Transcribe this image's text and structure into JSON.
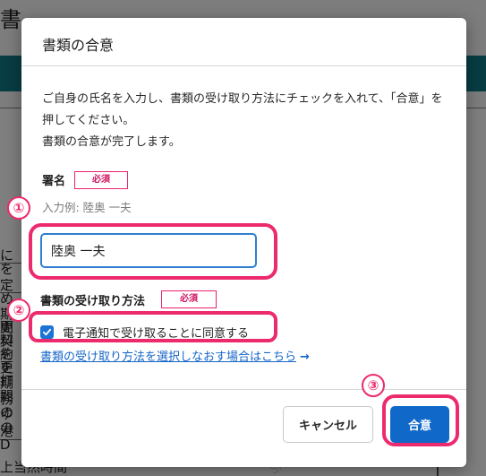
{
  "background": {
    "header_title": "書",
    "doc_fragments": [
      "にを",
      "定め",
      "期間",
      "更料",
      "契約",
      "を更",
      "を打",
      "期間",
      "務の",
      "ゆの",
      "港D",
      "上当然時間"
    ]
  },
  "dialog": {
    "title": "書類の合意",
    "intro": "ご自身の氏名を入力し、書類の受け取り方法にチェックを入れて、「合意」を押してください。\n書類の合意が完了します。",
    "signature": {
      "label": "署名",
      "required_badge": "必須",
      "example": "入力例: 陸奥 一夫",
      "value": "陸奥 一夫"
    },
    "delivery": {
      "label": "書類の受け取り方法",
      "required_badge": "必須",
      "checkbox_label": "電子通知で受け取ることに同意する",
      "checked": true,
      "reselect_link": "書類の受け取り方法を選択しなおす場合はこちら",
      "link_arrow": "→"
    },
    "footer": {
      "cancel_label": "キャンセル",
      "agree_label": "合意"
    }
  },
  "annotations": {
    "step1": "①",
    "step2": "②",
    "step3": "③",
    "highlight_color": "#ec2a6e"
  },
  "colors": {
    "accent": "#1068c9",
    "required": "#e8236f",
    "teal_bar": "#0e7a86"
  }
}
